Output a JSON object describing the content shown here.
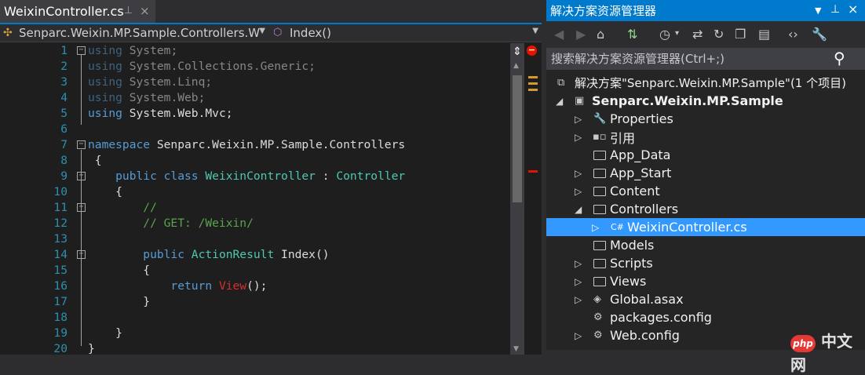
{
  "editor": {
    "tab_title": "WeixinController.cs",
    "tab_pin": "⊥",
    "tab_close": "×",
    "nav_left": "Senparc.Weixin.MP.Sample.Controllers.W",
    "nav_right": "Index()",
    "lines": [
      {
        "n": "1"
      },
      {
        "n": "2"
      },
      {
        "n": "3"
      },
      {
        "n": "4"
      },
      {
        "n": "5"
      },
      {
        "n": "6"
      },
      {
        "n": "7"
      },
      {
        "n": "8"
      },
      {
        "n": "9"
      },
      {
        "n": "10"
      },
      {
        "n": "11"
      },
      {
        "n": "12"
      },
      {
        "n": "13"
      },
      {
        "n": "14"
      },
      {
        "n": "15"
      },
      {
        "n": "16"
      },
      {
        "n": "17"
      },
      {
        "n": "18"
      },
      {
        "n": "19"
      },
      {
        "n": "20"
      }
    ],
    "code": {
      "l1_kw": "using",
      "l1_rest": " System;",
      "l2_kw": "using",
      "l2_rest": " System.Collections.Generic;",
      "l3_kw": "using",
      "l3_rest": " System.Linq;",
      "l4_kw": "using",
      "l4_rest": " System.Web;",
      "l5_kw": "using",
      "l5_rest": " System.Web.Mvc;",
      "l7_kw": "namespace",
      "l7_rest": " Senparc.Weixin.MP.Sample.Controllers",
      "l8": " {",
      "l9_kw": "    public class",
      "l9_name": " WeixinController ",
      "l9_colon": ":",
      "l9_type": " Controller",
      "l10": "    {",
      "l11": "        //",
      "l12": "        // GET: /Weixin/",
      "l14_kw": "        public",
      "l14_type": " ActionResult",
      "l14_rest": " Index()",
      "l15": "        {",
      "l16_kw": "            return",
      "l16_call": " View",
      "l16_rest": "();",
      "l17": "        }",
      "l19": "    }",
      "l20": "}"
    }
  },
  "solution_explorer": {
    "title": "解决方案资源管理器",
    "search_placeholder": "搜索解决方案资源管理器(Ctrl+;)",
    "solution_label": "解决方案\"Senparc.Weixin.MP.Sample\"(1 个项目)",
    "project_label": "Senparc.Weixin.MP.Sample",
    "items": [
      {
        "label": "Properties"
      },
      {
        "label": "引用"
      },
      {
        "label": "App_Data"
      },
      {
        "label": "App_Start"
      },
      {
        "label": "Content"
      },
      {
        "label": "Controllers"
      },
      {
        "label": "WeixinController.cs"
      },
      {
        "label": "Models"
      },
      {
        "label": "Scripts"
      },
      {
        "label": "Views"
      },
      {
        "label": "Global.asax"
      },
      {
        "label": "packages.config"
      },
      {
        "label": "Web.config"
      }
    ]
  },
  "watermark": {
    "logo": "php",
    "text": "中文网"
  },
  "colors": {
    "accent": "#007acc",
    "selection": "#3399ff",
    "keyword": "#569cd6",
    "type": "#4ec9b0",
    "comment": "#57a64a"
  }
}
